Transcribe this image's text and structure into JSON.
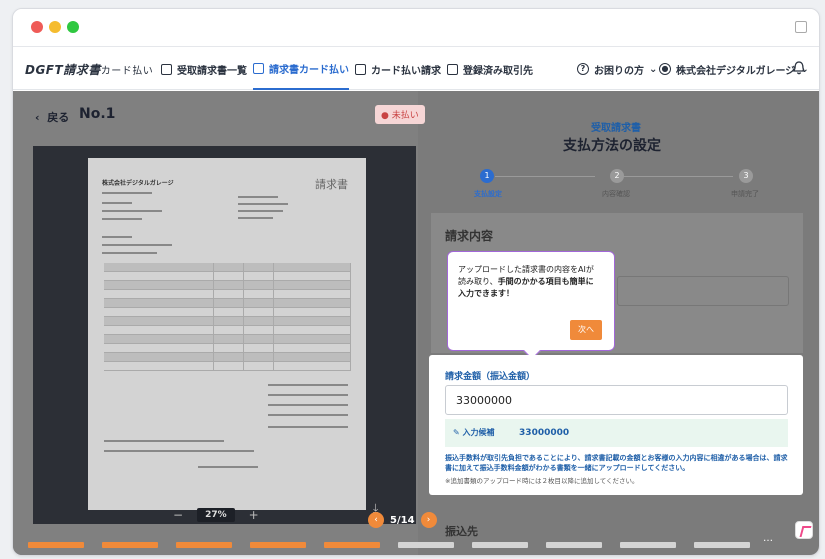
{
  "brand": {
    "logo": "DGFT請求書",
    "logo_sub": "カード払い"
  },
  "nav": {
    "items": [
      {
        "label": "受取請求書一覧"
      },
      {
        "label": "請求書カード払い"
      },
      {
        "label": "カード払い請求"
      },
      {
        "label": "登録済み取引先"
      }
    ],
    "help": "お困りの方",
    "account": "株式会社デジタルガレージ"
  },
  "detail": {
    "back": "戻る",
    "number": "No.1",
    "status": "未払い"
  },
  "invoice_preview": {
    "company": "株式会社デジタルガレージ",
    "title": "請求書"
  },
  "viewer": {
    "zoom": "27%",
    "zoom_out": "−",
    "zoom_in": "+"
  },
  "right": {
    "section_label": "受取請求書",
    "title": "支払方法の設定",
    "steps": [
      {
        "num": "1",
        "label": "支払設定"
      },
      {
        "num": "2",
        "label": "内容確認"
      },
      {
        "num": "3",
        "label": "申請完了"
      }
    ],
    "panel_title": "請求内容"
  },
  "tooltip": {
    "line1": "アップロードした請求書の内容をAIが",
    "line2": "読み取り、",
    "line2_bold": "手間のかかる項目も簡単に",
    "line3_bold": "入力できます！",
    "next": "次へ"
  },
  "amount": {
    "label": "請求金額（振込金額）",
    "value": "33000000",
    "candidate_label": "入力候補",
    "candidate_value": "33000000",
    "desc": "振込手数料が取引先負担であることにより、請求書記載の金額とお客様の入力内容に相違がある場合は、請求書に加えて振込手数料金額がわかる書類を一緒にアップロードしてください。",
    "note": "※追加書類のアップロード時には２枚目以降に追加してください。"
  },
  "bottom": {
    "section": "振込先",
    "pager": "5/14",
    "prev": "‹",
    "next": "›",
    "more": "…"
  },
  "colors": {
    "accent": "#2b6ccf",
    "orange": "#f08a3a",
    "tooltip_border": "#a267d8"
  },
  "progress": {
    "current": 5,
    "total": 14
  }
}
